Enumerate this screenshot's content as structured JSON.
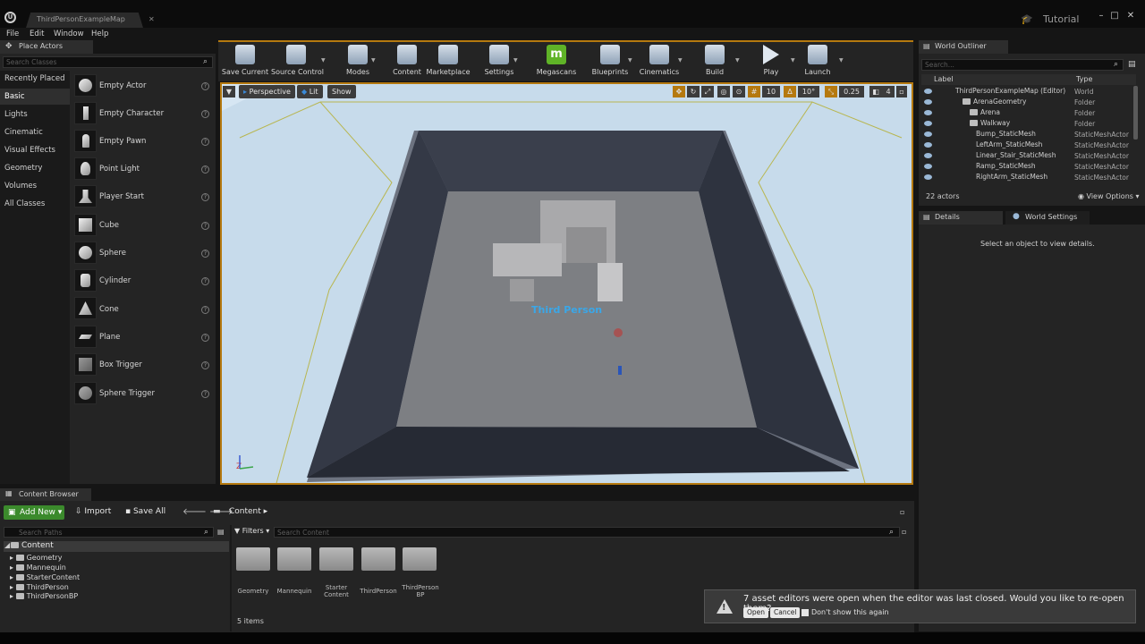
{
  "window": {
    "tab_title": "ThirdPersonExampleMap",
    "tutorial": "Tutorial",
    "menu": [
      "File",
      "Edit",
      "Window",
      "Help"
    ]
  },
  "place_actors": {
    "tab": "Place Actors",
    "search_placeholder": "Search Classes",
    "categories": [
      "Recently Placed",
      "Basic",
      "Lights",
      "Cinematic",
      "Visual Effects",
      "Geometry",
      "Volumes",
      "All Classes"
    ],
    "selected_category": "Basic",
    "actors": [
      "Empty Actor",
      "Empty Character",
      "Empty Pawn",
      "Point Light",
      "Player Start",
      "Cube",
      "Sphere",
      "Cylinder",
      "Cone",
      "Plane",
      "Box Trigger",
      "Sphere Trigger"
    ]
  },
  "toolbar": {
    "buttons": [
      "Save Current",
      "Source Control",
      "Modes",
      "Content",
      "Marketplace",
      "Settings",
      "Megascans",
      "Blueprints",
      "Cinematics",
      "Build",
      "Play",
      "Launch"
    ]
  },
  "viewport": {
    "perspective": "Perspective",
    "lit": "Lit",
    "show": "Show",
    "grid_snap": "10",
    "rot_snap": "10°",
    "scale_snap": "0.25",
    "cam_speed": "4",
    "actor_label": "Third Person"
  },
  "world_outliner": {
    "tab": "World Outliner",
    "search_placeholder": "Search...",
    "col_label": "Label",
    "col_type": "Type",
    "rows": [
      {
        "label": "ThirdPersonExampleMap (Editor)",
        "type": "World"
      },
      {
        "label": "ArenaGeometry",
        "type": "Folder"
      },
      {
        "label": "Arena",
        "type": "Folder"
      },
      {
        "label": "Walkway",
        "type": "Folder"
      },
      {
        "label": "Bump_StaticMesh",
        "type": "StaticMeshActor"
      },
      {
        "label": "LeftArm_StaticMesh",
        "type": "StaticMeshActor"
      },
      {
        "label": "Linear_Stair_StaticMesh",
        "type": "StaticMeshActor"
      },
      {
        "label": "Ramp_StaticMesh",
        "type": "StaticMeshActor"
      },
      {
        "label": "RightArm_StaticMesh",
        "type": "StaticMeshActor"
      }
    ],
    "count": "22 actors",
    "view_options": "View Options"
  },
  "details": {
    "tab": "Details",
    "world_settings_tab": "World Settings",
    "empty_message": "Select an object to view details."
  },
  "content_browser": {
    "tab": "Content Browser",
    "add_new": "Add New",
    "import": "Import",
    "save_all": "Save All",
    "path": "Content",
    "paths_placeholder": "Search Paths",
    "tree_root": "Content",
    "tree": [
      "Geometry",
      "Mannequin",
      "StarterContent",
      "ThirdPerson",
      "ThirdPersonBP"
    ],
    "filters": "Filters",
    "search_placeholder": "Search Content",
    "assets": [
      "Geometry",
      "Mannequin",
      "Starter Content",
      "ThirdPerson",
      "ThirdPerson BP"
    ],
    "items_count": "5 items"
  },
  "notification": {
    "text": "7 asset editors were open when the editor was last closed. Would you like to re-open them?",
    "open": "Open",
    "cancel": "Cancel",
    "dont_show": "Don't show this again"
  }
}
